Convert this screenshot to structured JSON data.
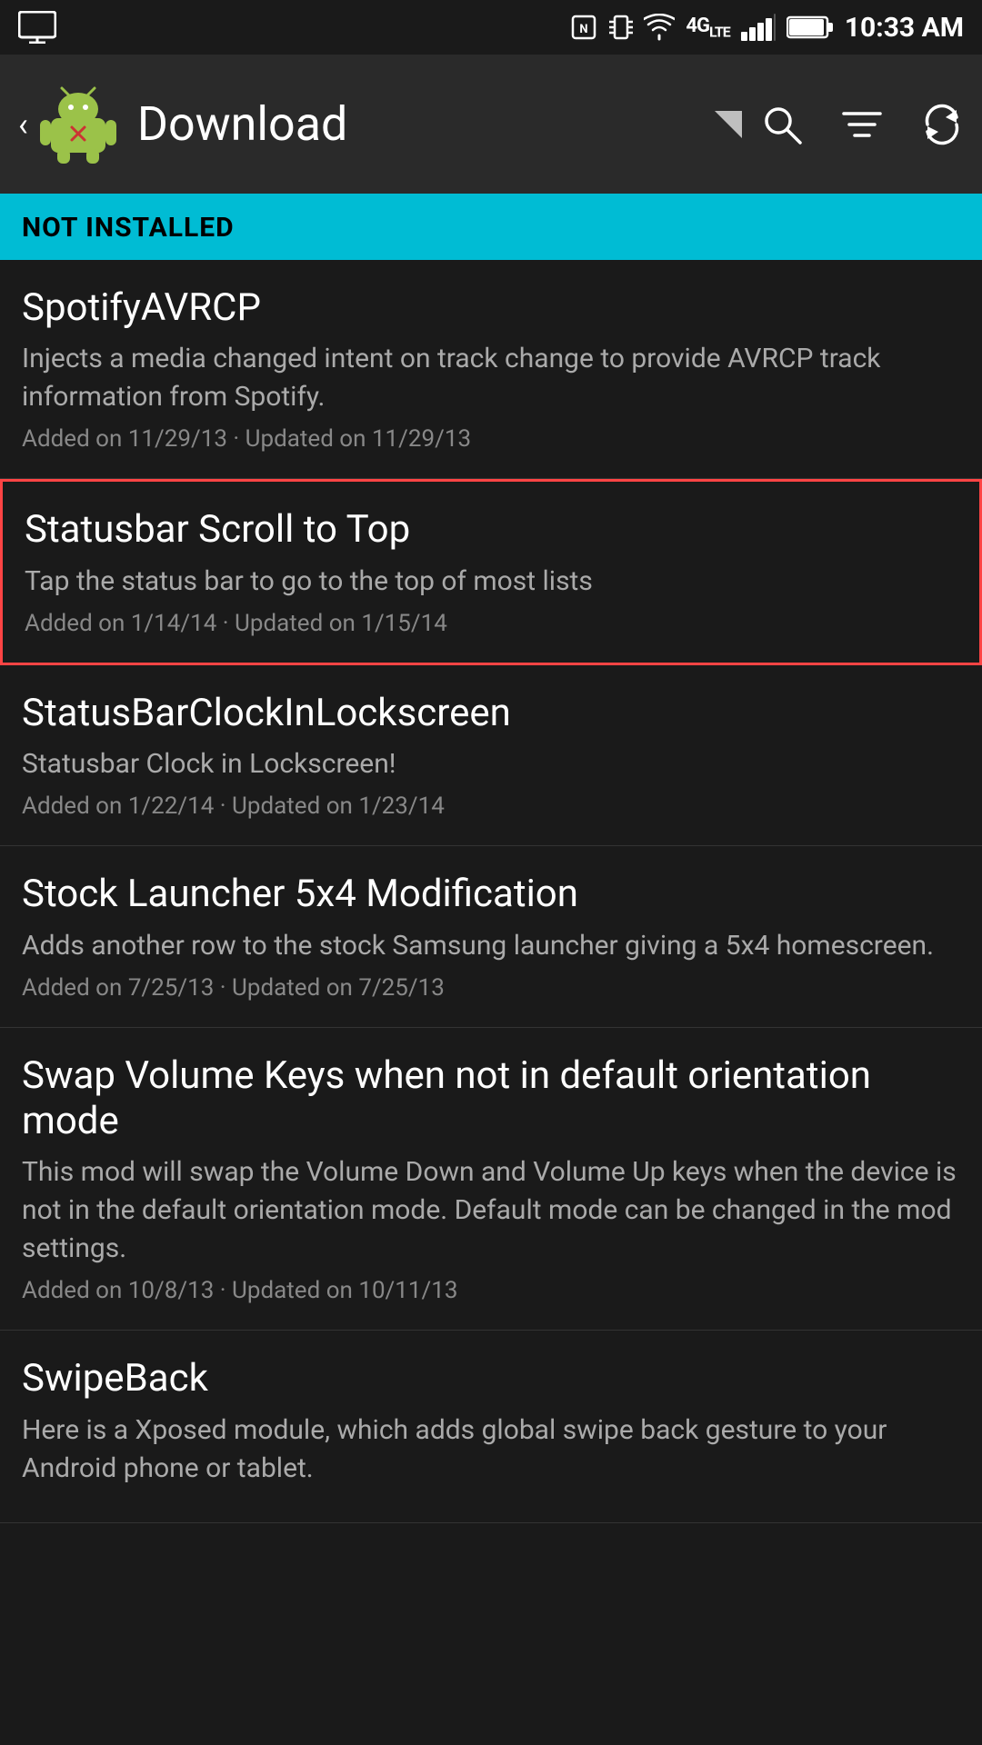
{
  "statusBar": {
    "time": "10:33 AM",
    "icons": [
      "nfc",
      "vibrate",
      "signal",
      "4g-lte",
      "wifi",
      "battery"
    ]
  },
  "appBar": {
    "title": "Download",
    "backLabel": "‹",
    "searchLabel": "Search",
    "filterLabel": "Filter",
    "refreshLabel": "Refresh"
  },
  "sectionHeader": {
    "label": "NOT INSTALLED"
  },
  "items": [
    {
      "id": "spotify-avrcp",
      "title": "SpotifyAVRCP",
      "description": "Injects a media changed intent on track change to provide AVRCP track information from Spotify.",
      "meta": "Added on 11/29/13 · Updated on 11/29/13",
      "selected": false
    },
    {
      "id": "statusbar-scroll-top",
      "title": "Statusbar Scroll to Top",
      "description": "Tap the status bar to go to the top of most lists",
      "meta": "Added on 1/14/14 · Updated on 1/15/14",
      "selected": true
    },
    {
      "id": "statusbar-clock-lockscreen",
      "title": "StatusBarClockInLockscreen",
      "description": "Statusbar Clock in Lockscreen!",
      "meta": "Added on 1/22/14 · Updated on 1/23/14",
      "selected": false
    },
    {
      "id": "stock-launcher",
      "title": "Stock Launcher 5x4 Modification",
      "description": "Adds another row to the stock Samsung launcher giving a 5x4 homescreen.",
      "meta": "Added on 7/25/13 · Updated on 7/25/13",
      "selected": false
    },
    {
      "id": "swap-volume-keys",
      "title": "Swap Volume Keys when not in default orientation mode",
      "description": "This mod will swap the Volume Down and Volume Up keys when the device is not in the default orientation mode. Default mode can be changed in the mod settings.",
      "meta": "Added on 10/8/13 · Updated on 10/11/13",
      "selected": false
    },
    {
      "id": "swipeback",
      "title": "SwipeBack",
      "description": "Here is a Xposed module, which adds global swipe back gesture to your Android phone or tablet.",
      "meta": "",
      "selected": false
    }
  ]
}
